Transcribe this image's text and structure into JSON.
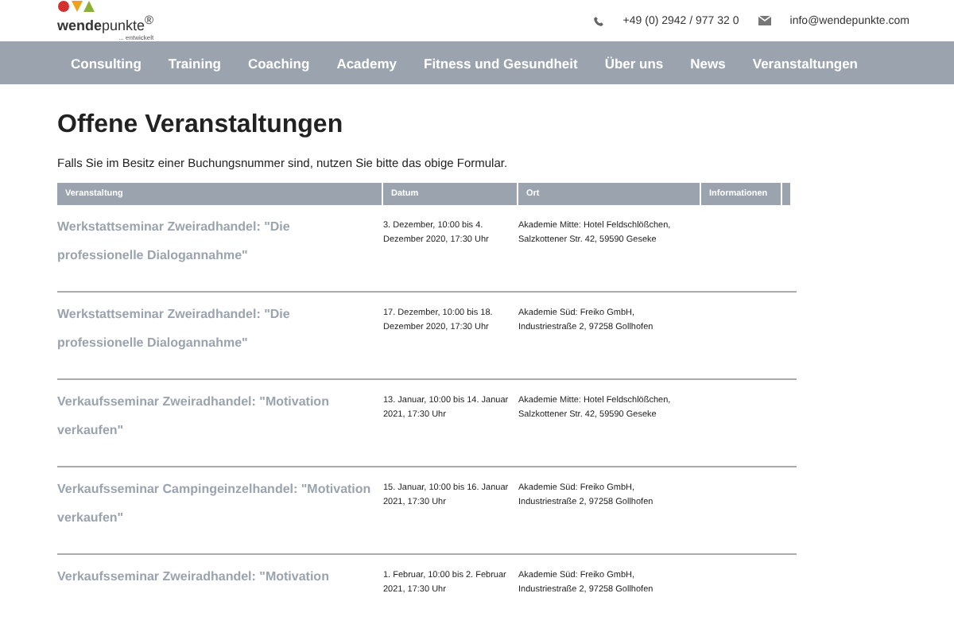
{
  "header": {
    "logo": {
      "name": "**wende**punkte$^{®}$",
      "tagline": "... entwickelt"
    },
    "phone": "+49 (0) 2942 / 977 32 0",
    "email": "info@wendepunkte.com"
  },
  "nav": [
    {
      "label": "Consulting"
    },
    {
      "label": "Training"
    },
    {
      "label": "Coaching"
    },
    {
      "label": "Academy"
    },
    {
      "label": "Fitness und Gesundheit"
    },
    {
      "label": "Über uns"
    },
    {
      "label": "News"
    },
    {
      "label": "Veranstaltungen"
    }
  ],
  "page": {
    "title": "Offene Veranstaltungen",
    "intro": "Falls Sie im Besitz einer Buchungsnummer sind, nutzen Sie bitte das obige Formular."
  },
  "table": {
    "columns": [
      "Veranstaltung",
      "Datum",
      "Ort",
      "Informationen"
    ],
    "rows": [
      {
        "event": "Werkstattseminar Zweiradhandel: \"Die professionelle Dialogannahme\"",
        "date": "3. Dezember, 10:00 bis 4. Dezember 2020, 17:30 Uhr",
        "place": "Akademie Mitte: Hotel Feldschlößchen, Salzkottener Str. 42, 59590 Geseke"
      },
      {
        "event": "Werkstattseminar Zweiradhandel: \"Die professionelle Dialogannahme\"",
        "date": "17. Dezember, 10:00 bis 18. Dezember 2020, 17:30 Uhr",
        "place": "Akademie Süd: Freiko GmbH, Industriestraße 2, 97258 Gollhofen"
      },
      {
        "event": "Verkaufsseminar Zweiradhandel: \"Motivation verkaufen\"",
        "date": "13. Januar, 10:00 bis 14. Januar 2021, 17:30 Uhr",
        "place": "Akademie Mitte: Hotel Feldschlößchen, Salzkottener Str. 42, 59590 Geseke"
      },
      {
        "event": "Verkaufsseminar Campingeinzelhandel: \"Motivation verkaufen\"",
        "date": "15. Januar, 10:00 bis 16. Januar 2021, 17:30 Uhr",
        "place": "Akademie Süd: Freiko GmbH, Industriestraße 2, 97258 Gollhofen"
      },
      {
        "event": "Verkaufsseminar Zweiradhandel: \"Motivation",
        "date": "1. Februar, 10:00 bis 2. Februar 2021, 17:30 Uhr",
        "place": "Akademie Süd: Freiko GmbH, Industriestraße 2, 97258 Gollhofen"
      }
    ]
  }
}
